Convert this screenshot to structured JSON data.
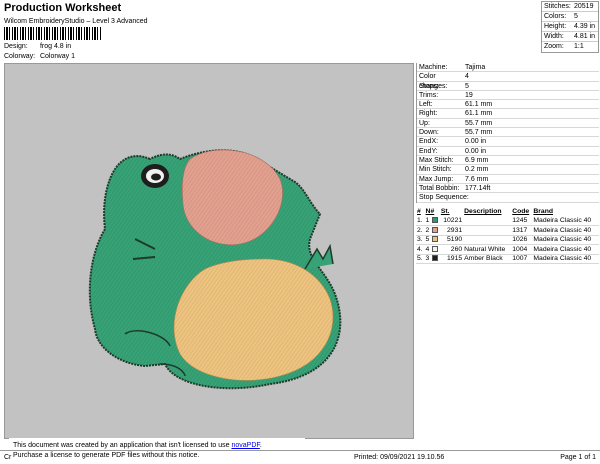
{
  "header": {
    "title": "Production Worksheet",
    "subtitle": "Wilcom EmbroideryStudio – Level 3 Advanced",
    "design_label": "Design:",
    "design_value": "frog 4.8 in",
    "colorway_label": "Colorway:",
    "colorway_value": "Colorway 1"
  },
  "stats": [
    {
      "k": "Stitches:",
      "v": "20519"
    },
    {
      "k": "Colors:",
      "v": "5"
    },
    {
      "k": "Height:",
      "v": "4.39 in"
    },
    {
      "k": "Width:",
      "v": "4.81 in"
    },
    {
      "k": "Zoom:",
      "v": "1:1"
    }
  ],
  "machine_info": [
    {
      "k": "Machine:",
      "v": "Tajima"
    },
    {
      "k": "Color changes:",
      "v": "4"
    },
    {
      "k": "Stops:",
      "v": "5"
    },
    {
      "k": "Trims:",
      "v": "19"
    },
    {
      "k": "Left:",
      "v": "61.1 mm"
    },
    {
      "k": "Right:",
      "v": "61.1 mm"
    },
    {
      "k": "Up:",
      "v": "55.7 mm"
    },
    {
      "k": "Down:",
      "v": "55.7 mm"
    },
    {
      "k": "EndX:",
      "v": "0.00 in"
    },
    {
      "k": "EndY:",
      "v": "0.00 in"
    },
    {
      "k": "Max Stitch:",
      "v": "6.9 mm"
    },
    {
      "k": "Min Stitch:",
      "v": "0.2 mm"
    },
    {
      "k": "Max Jump:",
      "v": "7.6 mm"
    },
    {
      "k": "Total Bobbin:",
      "v": "177.14ft"
    }
  ],
  "stop_sequence": {
    "heading": "Stop Sequence:",
    "columns": [
      "#",
      "N#",
      "St.",
      "Description",
      "Code",
      "Brand"
    ],
    "rows": [
      {
        "n": "1.",
        "needle": "1",
        "color": "#2f9a70",
        "st": "10221",
        "desc": "",
        "code": "1245",
        "brand": "Madeira Classic 40"
      },
      {
        "n": "2.",
        "needle": "2",
        "color": "#e3a08e",
        "st": "2931",
        "desc": "",
        "code": "1317",
        "brand": "Madeira Classic 40"
      },
      {
        "n": "3.",
        "needle": "5",
        "color": "#eec37f",
        "st": "5190",
        "desc": "",
        "code": "1026",
        "brand": "Madeira Classic 40"
      },
      {
        "n": "4.",
        "needle": "4",
        "color": "#f2f2f0",
        "st": "260",
        "desc": "Natural White",
        "code": "1004",
        "brand": "Madeira Classic 40"
      },
      {
        "n": "5.",
        "needle": "3",
        "color": "#1e1e1e",
        "st": "1915",
        "desc": "Amber Black",
        "code": "1007",
        "brand": "Madeira Classic 40"
      }
    ]
  },
  "notice": {
    "line1": "This document was created by an application that isn't licensed to use",
    "link": "novaPDF",
    "line1_end": ".",
    "line2": "Purchase a license to generate PDF files without this notice."
  },
  "footer": {
    "left": "Cr",
    "printed": "Printed: 09/09/2021 19.10.56",
    "page": "Page 1 of 1"
  }
}
